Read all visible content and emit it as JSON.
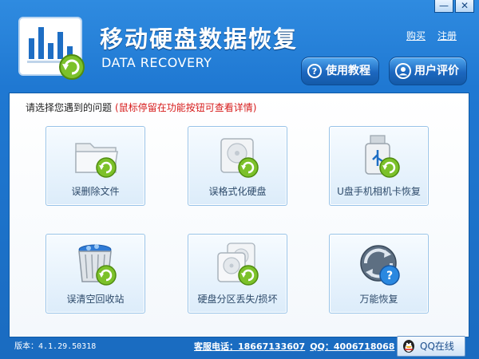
{
  "window": {
    "minimize_glyph": "—",
    "close_glyph": "✕"
  },
  "header": {
    "title": "移动硬盘数据恢复",
    "subtitle": "DATA RECOVERY",
    "links": {
      "buy": "购买",
      "register": "注册"
    },
    "buttons": {
      "tutorial": {
        "label": "使用教程",
        "icon": "question-circle-icon",
        "glyph": "?"
      },
      "review": {
        "label": "用户评价",
        "icon": "user-icon"
      }
    }
  },
  "panel": {
    "prompt": "请选择您遇到的问题",
    "hint": "(鼠标停留在功能按钮可查看详情)",
    "tiles": [
      {
        "label": "误删除文件",
        "icon": "folder-recover-icon"
      },
      {
        "label": "误格式化硬盘",
        "icon": "hard-drive-recover-icon"
      },
      {
        "label": "U盘手机相机卡恢复",
        "icon": "usb-drive-recover-icon"
      },
      {
        "label": "误清空回收站",
        "icon": "recycle-bin-recover-icon"
      },
      {
        "label": "硬盘分区丢失/损坏",
        "icon": "partition-recover-icon"
      },
      {
        "label": "万能恢复",
        "icon": "universal-recover-icon"
      }
    ]
  },
  "status": {
    "version": "版本：4.1.29.50318",
    "phone": "客服电话：18667133607",
    "qq": "QQ：4006718068",
    "qq_button": "QQ在线"
  },
  "colors": {
    "brand_blue": "#1f78d2",
    "hint_red": "#d61a1a",
    "recover_green": "#7cc12a"
  }
}
